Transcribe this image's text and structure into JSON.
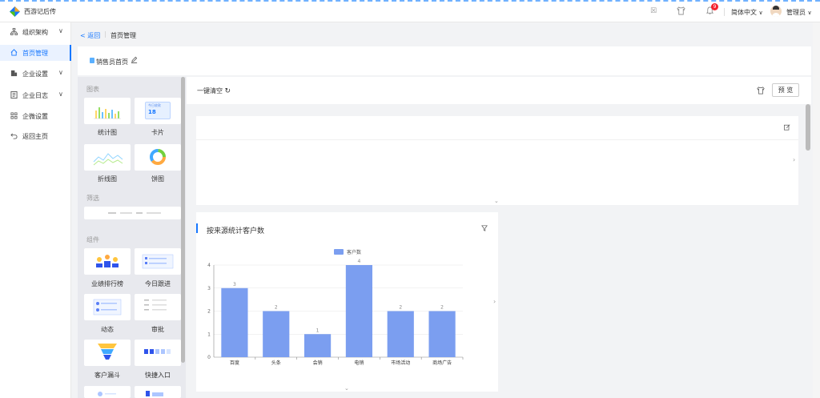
{
  "app": {
    "title": "西游记后传"
  },
  "topbar": {
    "notification_count": "9",
    "language": "简体中文",
    "user": "管理员"
  },
  "sidebar": {
    "items": [
      {
        "icon": "org-chart-icon",
        "label": "组织架构",
        "expandable": true
      },
      {
        "icon": "home-icon",
        "label": "首页管理",
        "active": true
      },
      {
        "icon": "building-icon",
        "label": "企业设置",
        "expandable": true
      },
      {
        "icon": "log-icon",
        "label": "企业日志",
        "expandable": true
      },
      {
        "icon": "grid-icon",
        "label": "企微设置"
      },
      {
        "icon": "return-icon",
        "label": "返回主页"
      }
    ]
  },
  "breadcrumb": {
    "back": "返回",
    "current": "首页管理"
  },
  "page": {
    "title": "销售员首页"
  },
  "palette": {
    "sections": {
      "chart": "图表",
      "filter": "筛选",
      "component": "组件"
    },
    "charts": [
      {
        "label": "统计图",
        "icon": "bar-chart-thumb"
      },
      {
        "label": "卡片",
        "icon": "card-thumb",
        "card_title": "今日收款",
        "card_value": "18"
      },
      {
        "label": "折线图",
        "icon": "line-chart-thumb"
      },
      {
        "label": "饼图",
        "icon": "pie-chart-thumb"
      }
    ],
    "components": [
      {
        "label": "业绩排行榜",
        "icon": "ranking-thumb"
      },
      {
        "label": "今日跟进",
        "icon": "followup-thumb"
      },
      {
        "label": "动态",
        "icon": "activity-thumb"
      },
      {
        "label": "审批",
        "icon": "approval-thumb"
      },
      {
        "label": "客户漏斗",
        "icon": "funnel-thumb"
      },
      {
        "label": "快捷入口",
        "icon": "shortcut-thumb"
      }
    ]
  },
  "toolbar": {
    "clear": "一键清空",
    "preview": "预 览"
  },
  "chart_card": {
    "title": "按来源统计客户数"
  },
  "chart_data": {
    "type": "bar",
    "categories": [
      "百度",
      "头条",
      "会销",
      "电销",
      "市场活动",
      "商场广告"
    ],
    "series": [
      {
        "name": "客户数",
        "values": [
          3,
          2,
          1,
          4,
          2,
          2
        ],
        "color": "#7b9ef0"
      }
    ],
    "ylim": [
      0,
      4
    ],
    "yticks": [
      0,
      1,
      2,
      3,
      4
    ],
    "legend": "top-center",
    "grid": true
  }
}
